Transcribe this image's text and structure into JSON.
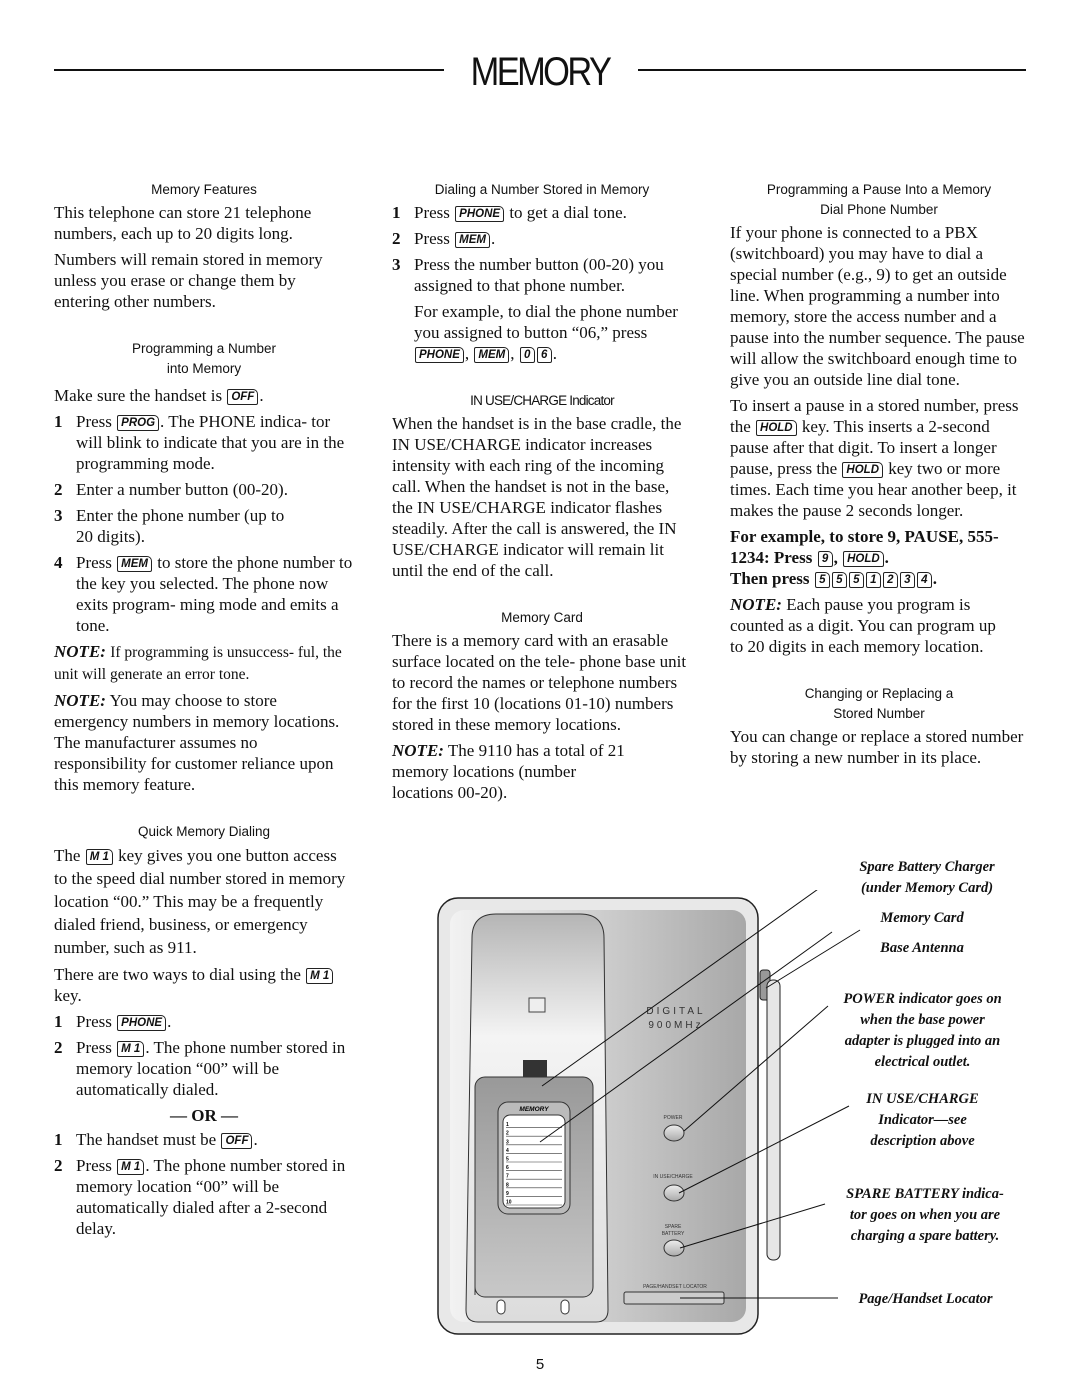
{
  "page": {
    "title": "MEMORY",
    "page_number": "5"
  },
  "col1": {
    "memory_features": {
      "heading": "Memory Features",
      "p1": "This telephone can store 21 telephone numbers, each up to 20 digits long.",
      "p2": "Numbers will remain stored in memory unless you erase or change them by entering other numbers."
    },
    "programming": {
      "heading_line1": "Programming a Number",
      "heading_line2": "into Memory",
      "intro_pre": "Make sure the handset is",
      "intro_post": ".",
      "steps": [
        {
          "n": "1",
          "pre": "Press",
          "post": ". The PHONE indica- tor will blink to indicate that you are in the programming mode."
        },
        {
          "n": "2",
          "text": "Enter a number button (00-20)."
        },
        {
          "n": "3",
          "text": "Enter the phone number (up to 20 digits)."
        },
        {
          "n": "4",
          "pre": "Press",
          "post": "to store the phone number to the key you selected. The phone now exits program- ming mode and emits a tone."
        }
      ],
      "note1_label": "NOTE:",
      "note1": "If programming is unsuccess- ful, the unit will generate an error tone.",
      "note2_label": "NOTE:",
      "note2": "You may choose to store emergency numbers in memory locations. The manufacturer assumes no responsibility for customer reliance upon this memory feature."
    },
    "quick_dial": {
      "heading": "Quick Memory Dialing",
      "p1_pre": "The",
      "p1_post": "key gives you one button access to the speed dial number stored in memory location “00.” This may be a frequently dialed friend, business, or emergency number, such as 911.",
      "p2_pre": "There are two ways to dial using the",
      "p2_post": "key.",
      "a_steps": [
        {
          "n": "1",
          "pre": "Press",
          "post": "."
        },
        {
          "n": "2",
          "pre": "Press",
          "post": ". The phone number stored in memory location “00” will be automatically dialed."
        }
      ],
      "or": "— OR —",
      "b_steps": [
        {
          "n": "1",
          "pre": "The handset must be",
          "post": "."
        },
        {
          "n": "2",
          "pre": "Press",
          "post": ". The phone number stored in memory location “00” will be automatically dialed after a 2-second delay."
        }
      ]
    }
  },
  "col2": {
    "dialing": {
      "heading": "Dialing a Number Stored in Memory",
      "steps": [
        {
          "n": "1",
          "pre": "Press",
          "post": "to get a dial tone."
        },
        {
          "n": "2",
          "pre": "Press",
          "post": "."
        },
        {
          "n": "3",
          "text": "Press the number button (00-20) you assigned to that phone number."
        }
      ],
      "example_pre": "For example, to dial the phone number you assigned to button “06,” press",
      "example_post": "."
    },
    "in_use": {
      "heading": "IN USE/CHARGE Indicator",
      "p1": "When the handset is in the base cradle, the IN USE/CHARGE indicator increases intensity with each ring of the incoming call. When the handset is not in the base, the IN USE/CHARGE indicator flashes steadily. After the call is answered, the IN USE/CHARGE indicator will remain lit until the end of the call."
    },
    "memory_card": {
      "heading": "Memory Card",
      "p1": "There is a memory card with an erasable surface located on the tele- phone base unit to record the names or telephone numbers for the first 10 (locations 01-10) numbers stored in these memory locations.",
      "note_label": "NOTE:",
      "note": "The 9110 has a total of 21 memory locations (number locations 00-20)."
    }
  },
  "col3": {
    "pause": {
      "heading_line1": "Programming a Pause Into a Memory",
      "heading_line2": "Dial Phone Number",
      "p1": "If your phone is connected to a PBX (switchboard) you may have to dial a special number (e.g., 9) to get an outside line. When programming a number into memory, store the access number and a pause into the number sequence. The pause will allow the switchboard enough time to give you an outside line dial tone.",
      "p2_a": "To insert a pause in a stored number, press the",
      "p2_b": "key. This inserts a 2-second pause after that digit. To insert a longer pause, press the",
      "p2_c": "key two or more times. Each time you hear another beep, it makes the pause 2 seconds longer.",
      "example_a": "For example, to store 9, PAUSE, 555-1234: Press",
      "example_sep": ",",
      "example_b": ".",
      "example_c": "Then press",
      "example_d": ".",
      "note_label": "NOTE:",
      "note": "Each pause you program is counted as a digit. You can program up to 20 digits in each memory location."
    },
    "changing": {
      "heading_line1": "Changing or Replacing a",
      "heading_line2": "Stored Number",
      "p1": "You can change or replace a stored number by storing a new number in its place."
    }
  },
  "keys": {
    "off": "OFF",
    "prog": "PROG",
    "mem": "MEM",
    "m1": "M 1",
    "phone": "PHONE",
    "hold": "HOLD",
    "d0": "0",
    "d6": "6",
    "d9": "9",
    "seq": [
      "5",
      "5",
      "5",
      "1",
      "2",
      "3",
      "4"
    ]
  },
  "diagram": {
    "brand_line1": "DIGITAL",
    "brand_line2": "900MHz",
    "card_title": "MEMORY",
    "card_lines": [
      "1",
      "2",
      "3",
      "4",
      "5",
      "6",
      "7",
      "8",
      "9",
      "10"
    ],
    "label_power": "POWER",
    "label_inuse": "IN USE/CHARGE",
    "label_spare1": "SPARE",
    "label_spare2": "BATTERY",
    "label_locator": "PAGE/HANDSET LOCATOR",
    "callouts": {
      "spare_charger": [
        "Spare Battery Charger",
        "(under Memory Card)"
      ],
      "memory_card": [
        "Memory Card"
      ],
      "antenna": [
        "Base Antenna"
      ],
      "power": [
        "POWER indicator goes on",
        "when the base power",
        "adapter is plugged into an",
        "electrical outlet."
      ],
      "in_use": [
        "IN USE/CHARGE",
        "Indicator—see",
        "description above"
      ],
      "spare_battery": [
        "SPARE BATTERY indica-",
        "tor goes on when you are",
        "charging a spare battery."
      ],
      "locator": [
        "Page/Handset Locator"
      ]
    }
  }
}
